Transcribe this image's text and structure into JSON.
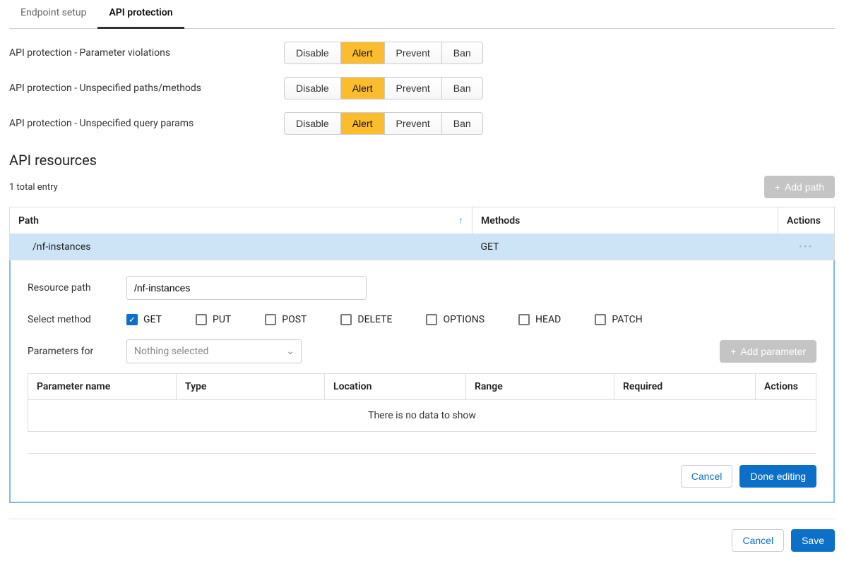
{
  "tabs": {
    "endpoint_setup": "Endpoint setup",
    "api_protection": "API protection"
  },
  "settings": [
    {
      "label": "API protection - Parameter violations",
      "options": [
        "Disable",
        "Alert",
        "Prevent",
        "Ban"
      ],
      "selected": "Alert"
    },
    {
      "label": "API protection - Unspecified paths/methods",
      "options": [
        "Disable",
        "Alert",
        "Prevent",
        "Ban"
      ],
      "selected": "Alert"
    },
    {
      "label": "API protection - Unspecified query params",
      "options": [
        "Disable",
        "Alert",
        "Prevent",
        "Ban"
      ],
      "selected": "Alert"
    }
  ],
  "resources_heading": "API resources",
  "entry_count": "1 total entry",
  "add_path": "Add path",
  "table": {
    "headers": {
      "path": "Path",
      "methods": "Methods",
      "actions": "Actions"
    },
    "row": {
      "path": "/nf-instances",
      "methods": "GET"
    }
  },
  "form": {
    "resource_path_label": "Resource path",
    "resource_path_value": "/nf-instances",
    "select_method_label": "Select method",
    "methods": [
      {
        "name": "GET",
        "checked": true
      },
      {
        "name": "PUT",
        "checked": false
      },
      {
        "name": "POST",
        "checked": false
      },
      {
        "name": "DELETE",
        "checked": false
      },
      {
        "name": "OPTIONS",
        "checked": false
      },
      {
        "name": "HEAD",
        "checked": false
      },
      {
        "name": "PATCH",
        "checked": false
      }
    ],
    "parameters_for_label": "Parameters for",
    "parameters_for_placeholder": "Nothing selected",
    "add_parameter": "Add parameter",
    "param_headers": {
      "name": "Parameter name",
      "type": "Type",
      "location": "Location",
      "range": "Range",
      "required": "Required",
      "actions": "Actions"
    },
    "no_data": "There is no data to show",
    "cancel": "Cancel",
    "done": "Done editing"
  },
  "footer": {
    "cancel": "Cancel",
    "save": "Save"
  }
}
